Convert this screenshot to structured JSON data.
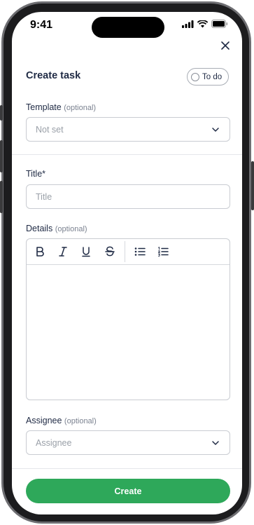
{
  "status_bar": {
    "time": "9:41"
  },
  "form": {
    "title": "Create task",
    "status": "To do",
    "template": {
      "label": "Template",
      "optional": "(optional)",
      "value": "Not set"
    },
    "title_field": {
      "label": "Title*",
      "placeholder": "Title"
    },
    "details": {
      "label": "Details",
      "optional": "(optional)"
    },
    "assignee": {
      "label": "Assignee",
      "optional": "(optional)",
      "placeholder": "Assignee"
    },
    "create_label": "Create"
  },
  "toolbar": {
    "icons": [
      "bold-icon",
      "italic-icon",
      "underline-icon",
      "strikethrough-icon",
      "bullet-list-icon",
      "numbered-list-icon"
    ]
  },
  "colors": {
    "accent": "#2ea85a",
    "text": "#1f2a44",
    "border": "#c9ccd2"
  }
}
